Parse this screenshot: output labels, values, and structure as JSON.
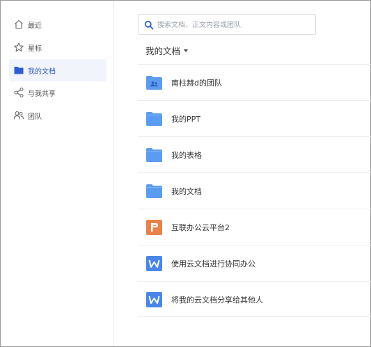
{
  "sidebar": {
    "items": [
      {
        "label": "最近",
        "icon": "home-icon",
        "active": false
      },
      {
        "label": "星标",
        "icon": "star-icon",
        "active": false
      },
      {
        "label": "我的文档",
        "icon": "folder-icon",
        "active": true
      },
      {
        "label": "与我共享",
        "icon": "share-icon",
        "active": false
      },
      {
        "label": "团队",
        "icon": "team-icon",
        "active": false
      }
    ]
  },
  "search": {
    "placeholder": "搜索文档、正文内容或团队"
  },
  "main": {
    "heading": "我的文档",
    "files": [
      {
        "name": "南柱赫d的团队",
        "icon": "team-folder-icon"
      },
      {
        "name": "我的PPT",
        "icon": "folder-icon"
      },
      {
        "name": "我的表格",
        "icon": "folder-icon"
      },
      {
        "name": "我的文档",
        "icon": "folder-icon"
      },
      {
        "name": "互联办公云平台2",
        "icon": "presentation-file-icon"
      },
      {
        "name": "使用云文档进行协同办公",
        "icon": "word-file-icon"
      },
      {
        "name": "将我的云文档分享给其他人",
        "icon": "word-file-icon"
      }
    ]
  },
  "colors": {
    "accent": "#2f5dd3",
    "folder": "#5b9cf0",
    "presentation": "#e8824a",
    "word": "#4a86e8"
  }
}
